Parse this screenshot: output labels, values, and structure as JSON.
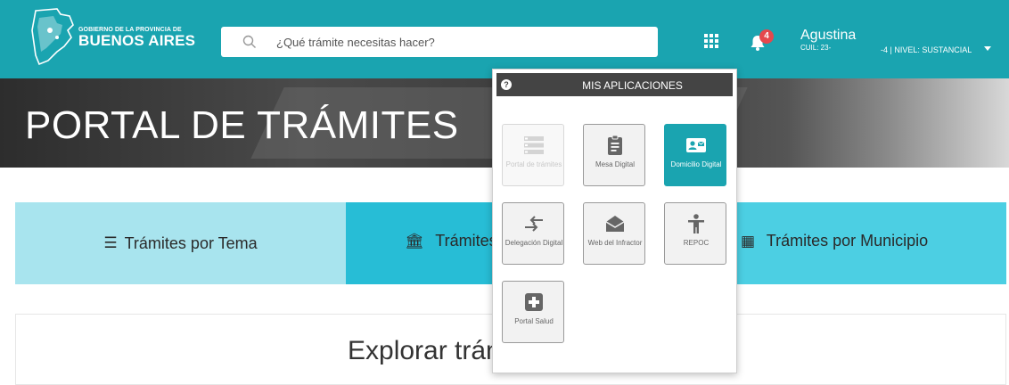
{
  "header": {
    "logo": {
      "line1": "GOBIERNO DE LA PROVINCIA DE",
      "line2": "BUENOS AIRES"
    },
    "search": {
      "placeholder": "¿Qué trámite necesitas hacer?",
      "icon": "search-icon"
    },
    "apps_icon": "grid-icon",
    "notifications": {
      "icon": "bell-icon",
      "count": "4"
    },
    "user": {
      "name": "Agustina",
      "cuil": "CUIL: 23-",
      "level": "-4 | NIVEL: SUSTANCIAL"
    }
  },
  "hero": {
    "title": "PORTAL DE TRÁMITES"
  },
  "tiles": [
    {
      "label": "Trámites por Tema",
      "icon": "list-icon"
    },
    {
      "label": "Trámites",
      "icon": "building-icon"
    },
    {
      "label": "Trámites por Municipio",
      "icon": "office-icon"
    }
  ],
  "explore": {
    "title": "Explorar trám"
  },
  "apps_menu": {
    "title": "MIS APLICACIONES",
    "help_icon": "?",
    "apps": [
      {
        "label": "Portal de trámites",
        "icon": "list-icon",
        "state": "disabled"
      },
      {
        "label": "Mesa Digital",
        "icon": "clipboard-icon",
        "state": "normal"
      },
      {
        "label": "Domicilio Digital",
        "icon": "id-card-icon",
        "state": "active"
      },
      {
        "label": "Delegación Digital",
        "icon": "arrows-icon",
        "state": "normal"
      },
      {
        "label": "Web del Infractor",
        "icon": "envelope-icon",
        "state": "normal"
      },
      {
        "label": "REPOC",
        "icon": "person-icon",
        "state": "normal"
      },
      {
        "label": "Portal Salud",
        "icon": "plus-icon",
        "state": "normal"
      }
    ]
  },
  "colors": {
    "header": "#1aa4b0",
    "tile1": "#a8e4ee",
    "tile2": "#27bdd6",
    "tile3": "#4ccfe3",
    "popup_head": "#444444",
    "badge": "#e5484d"
  }
}
